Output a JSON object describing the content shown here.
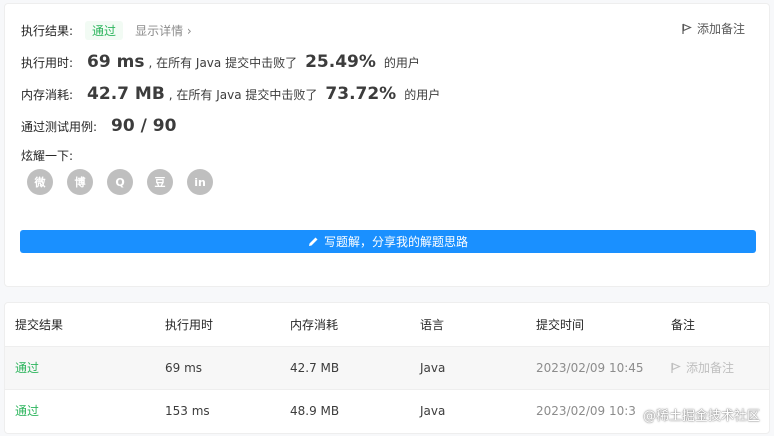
{
  "summary": {
    "result_label": "执行结果:",
    "result_value": "通过",
    "details_link": "显示详情",
    "add_note": "添加备注",
    "runtime": {
      "label": "执行用时:",
      "value": "69 ms",
      "middle": ", 在所有 Java 提交中击败了",
      "percent": "25.49%",
      "suffix": "的用户"
    },
    "memory": {
      "label": "内存消耗:",
      "value": "42.7 MB",
      "middle": ", 在所有 Java 提交中击败了",
      "percent": "73.72%",
      "suffix": "的用户"
    },
    "testcases": {
      "label": "通过测试用例:",
      "value": "90 / 90"
    },
    "share_label": "炫耀一下:",
    "share_icons": [
      "wechat-icon",
      "weibo-icon",
      "qq-icon",
      "douban-icon",
      "linkedin-icon"
    ],
    "share_glyphs": [
      "微",
      "博",
      "Q",
      "豆",
      "in"
    ],
    "solution_button": "写题解，分享我的解题思路"
  },
  "table": {
    "headers": [
      "提交结果",
      "执行用时",
      "内存消耗",
      "语言",
      "提交时间",
      "备注"
    ],
    "rows": [
      {
        "status": "通过",
        "runtime": "69 ms",
        "memory": "42.7 MB",
        "language": "Java",
        "time": "2023/02/09 10:45",
        "note": "添加备注"
      },
      {
        "status": "通过",
        "runtime": "153 ms",
        "memory": "48.9 MB",
        "language": "Java",
        "time": "2023/02/09 10:3",
        "note": ""
      }
    ]
  },
  "watermark": "@稀土掘金技术社区",
  "colors": {
    "accent": "#1a90ff",
    "success": "#2db55d",
    "icon_gray": "#bfbfbf"
  }
}
